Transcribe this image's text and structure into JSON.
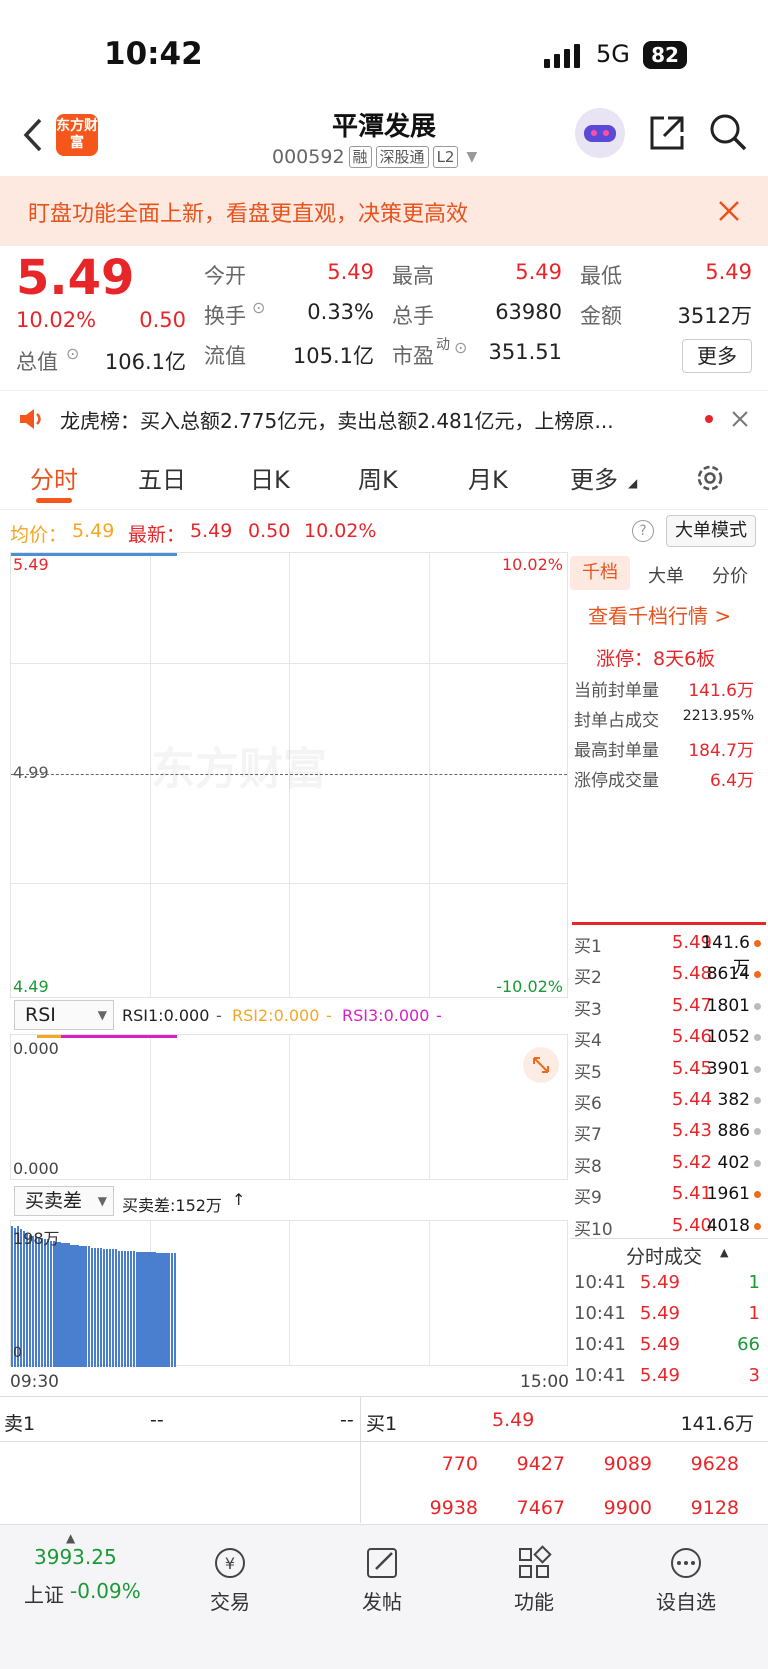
{
  "status_bar": {
    "time": "10:42",
    "network": "5G",
    "battery": "82"
  },
  "header": {
    "logo_text": "东方财富",
    "title": "平潭发展",
    "code": "000592",
    "tags": [
      "融",
      "深股通",
      "L2"
    ]
  },
  "banner": {
    "text": "盯盘功能全面上新，看盘更直观，决策更高效"
  },
  "quote": {
    "price": "5.49",
    "change_pct": "10.02%",
    "change": "0.50",
    "market_cap_label": "总值",
    "market_cap": "106.1亿",
    "open_label": "今开",
    "open": "5.49",
    "high_label": "最高",
    "high": "5.49",
    "low_label": "最低",
    "low": "5.49",
    "turnover_label": "换手",
    "turnover": "0.33%",
    "volume_label": "总手",
    "volume": "63980",
    "amount_label": "金额",
    "amount": "3512万",
    "float_label": "流值",
    "float_cap": "105.1亿",
    "pe_label": "市盈",
    "pe_sup": "动",
    "pe": "351.51",
    "more": "更多"
  },
  "notice": {
    "text": "龙虎榜：买入总额2.775亿元，卖出总额2.481亿元，上榜原..."
  },
  "tabs": [
    "分时",
    "五日",
    "日K",
    "周K",
    "月K",
    "更多"
  ],
  "price_line": {
    "avg_label": "均价：",
    "avg": "5.49",
    "latest_label": "最新：",
    "latest": "5.49",
    "change": "0.50",
    "pct": "10.02%",
    "mode": "大单模式"
  },
  "chart": {
    "top_price": "5.49",
    "mid_price": "4.99",
    "bottom_price": "4.49",
    "top_pct": "10.02%",
    "bottom_pct": "-10.02%",
    "watermark": "东方财富",
    "start_time": "09:30",
    "end_time": "15:00"
  },
  "rsi": {
    "selector": "RSI",
    "rsi1": "RSI1:0.000",
    "rsi2": "RSI2:0.000",
    "rsi3": "RSI3:0.000",
    "top": "0.000",
    "bottom": "0.000",
    "sep": "-"
  },
  "bsd": {
    "selector": "买卖差",
    "label": "买卖差:152万",
    "top": "198万",
    "bottom": "0",
    "bars": [
      0.99,
      0.98,
      0.99,
      0.97,
      0.96,
      0.94,
      0.93,
      0.92,
      0.92,
      0.91,
      0.91,
      0.9,
      0.9,
      0.89,
      0.89,
      0.88,
      0.88,
      0.87,
      0.87,
      0.87,
      0.86,
      0.86,
      0.86,
      0.85,
      0.85,
      0.85,
      0.85,
      0.84,
      0.84,
      0.84,
      0.84,
      0.83,
      0.83,
      0.83,
      0.83,
      0.83,
      0.82,
      0.82,
      0.82,
      0.82,
      0.82,
      0.82,
      0.81,
      0.81,
      0.81,
      0.81,
      0.81,
      0.81,
      0.81,
      0.8,
      0.8,
      0.8,
      0.8,
      0.8,
      0.8,
      0.8
    ]
  },
  "right_panel": {
    "tabs": [
      "千档",
      "大单",
      "分价"
    ],
    "view_link": "查看千档行情 >",
    "limit_up": "涨停：8天6板",
    "stats": [
      {
        "k": "当前封单量",
        "v": "141.6万"
      },
      {
        "k": "封单占成交",
        "v": "2213.95%"
      },
      {
        "k": "最高封单量",
        "v": "184.7万"
      },
      {
        "k": "涨停成交量",
        "v": "6.4万"
      }
    ],
    "bids": [
      {
        "k": "买1",
        "p": "5.49",
        "v": "141.6万",
        "dot": "#f06a1a"
      },
      {
        "k": "买2",
        "p": "5.48",
        "v": "8614",
        "dot": "#f06a1a"
      },
      {
        "k": "买3",
        "p": "5.47",
        "v": "1801",
        "dot": "#bbbbbb"
      },
      {
        "k": "买4",
        "p": "5.46",
        "v": "1052",
        "dot": "#bbbbbb"
      },
      {
        "k": "买5",
        "p": "5.45",
        "v": "3901",
        "dot": "#bbbbbb"
      },
      {
        "k": "买6",
        "p": "5.44",
        "v": "382",
        "dot": "#bbbbbb"
      },
      {
        "k": "买7",
        "p": "5.43",
        "v": "886",
        "dot": "#bbbbbb"
      },
      {
        "k": "买8",
        "p": "5.42",
        "v": "402",
        "dot": "#bbbbbb"
      },
      {
        "k": "买9",
        "p": "5.41",
        "v": "1961",
        "dot": "#f06a1a"
      },
      {
        "k": "买10",
        "p": "5.40",
        "v": "4018",
        "dot": "#f06a1a"
      }
    ],
    "ticks_title": "分时成交",
    "ticks": [
      {
        "t": "10:41",
        "p": "5.49",
        "v": "1",
        "c": "#1a9a36"
      },
      {
        "t": "10:41",
        "p": "5.49",
        "v": "1",
        "c": "#e8262a"
      },
      {
        "t": "10:41",
        "p": "5.49",
        "v": "66",
        "c": "#1a9a36"
      },
      {
        "t": "10:41",
        "p": "5.49",
        "v": "3",
        "c": "#e8262a"
      }
    ]
  },
  "order_book": {
    "sell_label": "卖1",
    "sell_p": "--",
    "sell_v": "--",
    "buy_label": "买1",
    "buy_p": "5.49",
    "buy_v": "141.6万",
    "queue": [
      "770",
      "9427",
      "9089",
      "9628",
      "9938",
      "7467",
      "9900",
      "9128"
    ]
  },
  "bottom_bar": {
    "index_value": "3993.25",
    "index_name": "上证",
    "index_change": "-0.09%",
    "items": [
      "交易",
      "发帖",
      "功能",
      "设自选"
    ]
  }
}
